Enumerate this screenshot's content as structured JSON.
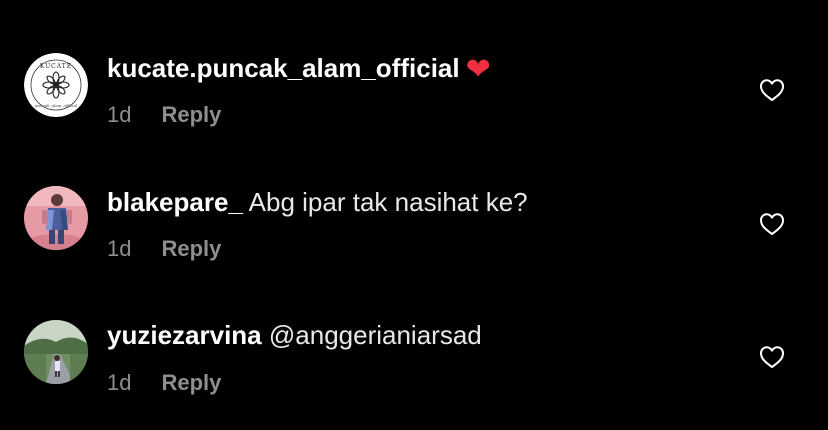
{
  "comments": [
    {
      "username": "kucate.puncak_alam_official",
      "text": "",
      "emoji": "❤",
      "time": "1d",
      "reply_label": "Reply",
      "avatar_lettering": "KUCATE puncak_alam_official",
      "like_icon": "heart-outline-icon"
    },
    {
      "username": "blakepare_",
      "text": "Abg ipar tak nasihat ke?",
      "time": "1d",
      "reply_label": "Reply",
      "like_icon": "heart-outline-icon"
    },
    {
      "username": "yuziezarvina",
      "text": "@anggerianiarsad",
      "time": "1d",
      "reply_label": "Reply",
      "like_icon": "heart-outline-icon"
    }
  ],
  "colors": {
    "background": "#000000",
    "username": "#ffffff",
    "secondary_text": "#8e8e8e",
    "heart_emoji": "#f0303e"
  }
}
